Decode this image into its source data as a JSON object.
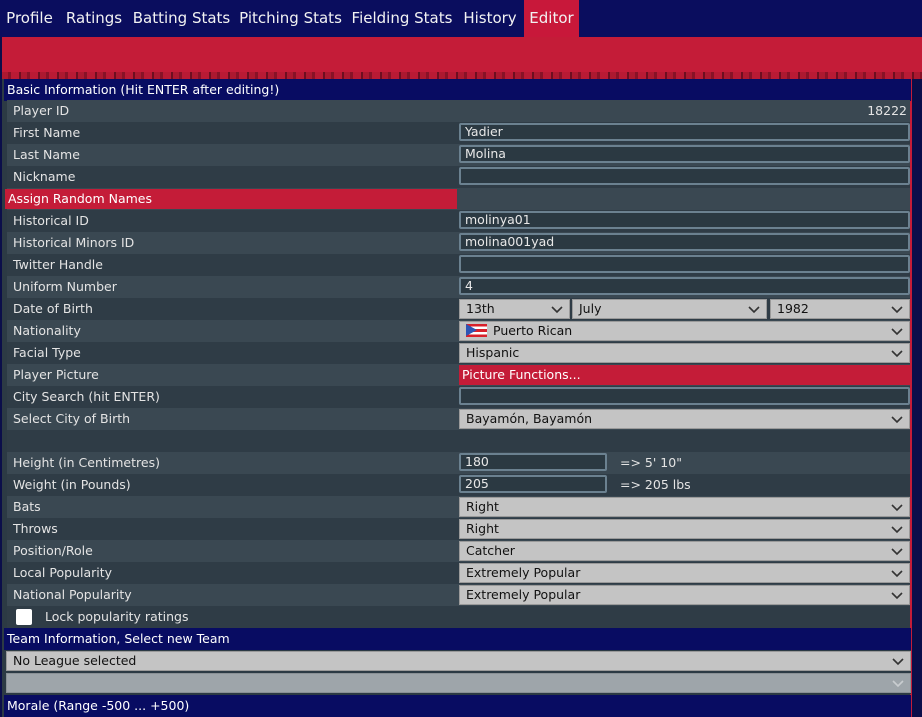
{
  "tabs": [
    "Profile",
    "Ratings",
    "Batting Stats",
    "Pitching Stats",
    "Fielding Stats",
    "History",
    "Editor"
  ],
  "active_tab": "Editor",
  "basic_section": "Basic Information (Hit ENTER after editing!)",
  "player_id": {
    "label": "Player ID",
    "value": "18222"
  },
  "first_name": {
    "label": "First Name",
    "value": "Yadier"
  },
  "last_name": {
    "label": "Last Name",
    "value": "Molina"
  },
  "nickname": {
    "label": "Nickname",
    "value": ""
  },
  "assign_random_names": "Assign Random Names",
  "historical_id": {
    "label": "Historical ID",
    "value": "molinya01"
  },
  "historical_minors_id": {
    "label": "Historical Minors ID",
    "value": "molina001yad"
  },
  "twitter": {
    "label": "Twitter Handle",
    "value": ""
  },
  "uniform": {
    "label": "Uniform Number",
    "value": "4"
  },
  "dob": {
    "label": "Date of Birth",
    "day": "13th",
    "month": "July",
    "year": "1982"
  },
  "nationality": {
    "label": "Nationality",
    "value": "Puerto Rican",
    "flag_icon": "puerto-rico-flag"
  },
  "facial_type": {
    "label": "Facial Type",
    "value": "Hispanic"
  },
  "player_picture": {
    "label": "Player Picture",
    "button": "Picture Functions..."
  },
  "city_search": {
    "label": "City Search (hit ENTER)",
    "value": ""
  },
  "city_of_birth": {
    "label": "Select City of Birth",
    "value": "Bayamón, Bayamón"
  },
  "height": {
    "label": "Height (in Centimetres)",
    "value": "180",
    "converted": "=> 5' 10\""
  },
  "weight": {
    "label": "Weight (in Pounds)",
    "value": "205",
    "converted": "=> 205 lbs"
  },
  "bats": {
    "label": "Bats",
    "value": "Right"
  },
  "throws": {
    "label": "Throws",
    "value": "Right"
  },
  "position": {
    "label": "Position/Role",
    "value": "Catcher"
  },
  "local_popularity": {
    "label": "Local Popularity",
    "value": "Extremely Popular"
  },
  "national_popularity": {
    "label": "National Popularity",
    "value": "Extremely Popular"
  },
  "lock_popularity": {
    "label": "Lock popularity ratings",
    "checked": false
  },
  "team_section": "Team Information, Select new Team",
  "league_select": "No League selected",
  "team_select": "",
  "morale_section": "Morale (Range -500 ... +500)",
  "colors": {
    "tab_bar": "#0a0d5e",
    "accent": "#c41c38",
    "panel": "#2c3a44"
  }
}
